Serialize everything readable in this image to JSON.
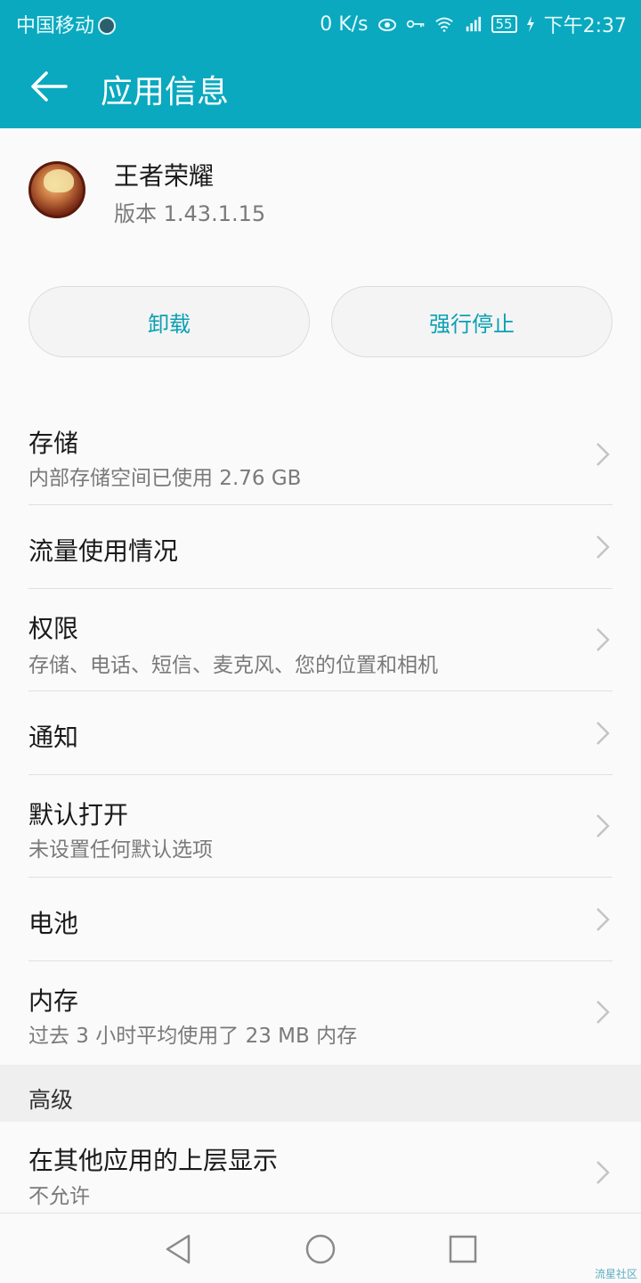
{
  "status_bar": {
    "carrier": "中国移动",
    "network_speed": "0 K/s",
    "battery": "55",
    "time": "下午2:37",
    "icons": [
      "eye-icon",
      "key-icon",
      "wifi-icon",
      "signal-icon",
      "charging-icon"
    ]
  },
  "app_bar": {
    "title": "应用信息",
    "back_icon": "arrow-left-icon"
  },
  "app": {
    "name": "王者荣耀",
    "version": "版本 1.43.1.15"
  },
  "actions": {
    "uninstall": "卸载",
    "force_stop": "强行停止"
  },
  "items": [
    {
      "title": "存储",
      "subtitle": "内部存储空间已使用 2.76 GB"
    },
    {
      "title": "流量使用情况",
      "subtitle": ""
    },
    {
      "title": "权限",
      "subtitle": "存储、电话、短信、麦克风、您的位置和相机"
    },
    {
      "title": "通知",
      "subtitle": ""
    },
    {
      "title": "默认打开",
      "subtitle": "未设置任何默认选项"
    },
    {
      "title": "电池",
      "subtitle": ""
    },
    {
      "title": "内存",
      "subtitle": "过去 3 小时平均使用了 23 MB 内存"
    }
  ],
  "advanced": {
    "header": "高级",
    "item_title": "在其他应用的上层显示",
    "item_subtitle": "不允许"
  },
  "watermark": "流星社区",
  "colors": {
    "accent": "#0aa9bf",
    "button_text": "#0aa0b4"
  }
}
